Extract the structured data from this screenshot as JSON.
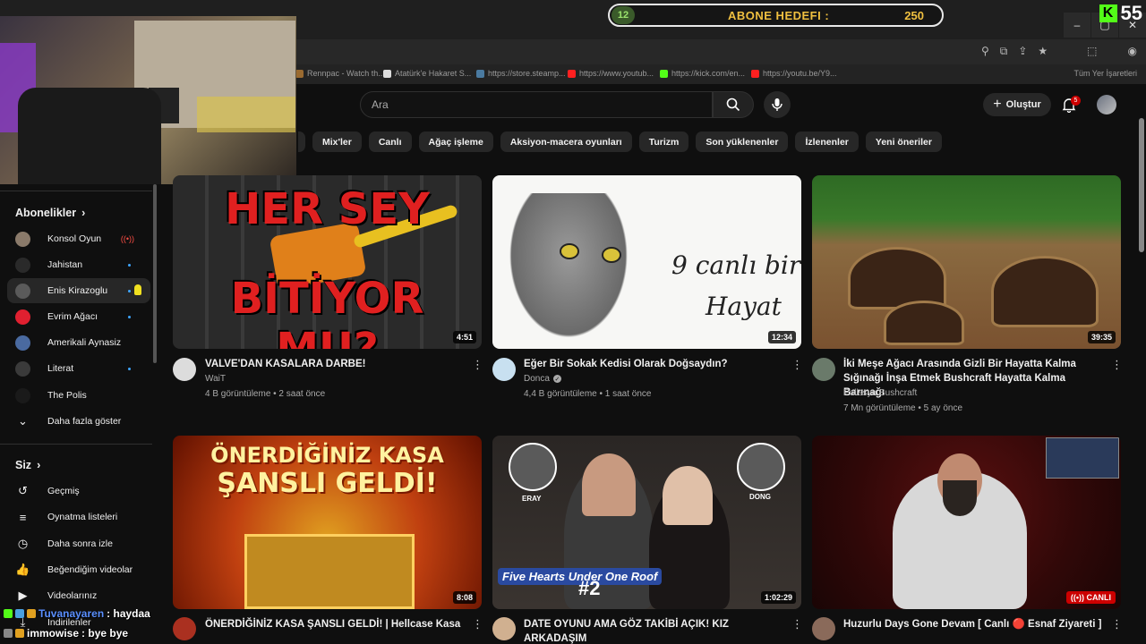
{
  "overlay": {
    "goal_count": "12",
    "goal_label": "ABONE HEDEFI :",
    "goal_target": "250",
    "kick_viewers": "55",
    "kick_logo": "K"
  },
  "window_controls": [
    "–",
    "▢",
    "✕"
  ],
  "bookmarks": [
    {
      "label": "Rennpac - Watch th...",
      "color": "#9a6a30"
    },
    {
      "label": "Atatürk'e Hakaret S...",
      "color": "#dddddd"
    },
    {
      "label": "https://store.steamp...",
      "color": "#4a7aa0"
    },
    {
      "label": "https://www.youtub...",
      "color": "#ff2020"
    },
    {
      "label": "https://kick.com/en...",
      "color": "#53fc18"
    },
    {
      "label": "https://youtu.be/Y9...",
      "color": "#ff2020"
    }
  ],
  "bookmarks_right": "Tüm Yer İşaretleri",
  "header": {
    "search_placeholder": "Ara",
    "create_label": "Oluştur",
    "notif_count": "5"
  },
  "chips": [
    "",
    "Mix'ler",
    "Canlı",
    "Ağaç işleme",
    "Aksiyon-macera oyunları",
    "Turizm",
    "Son yüklenenler",
    "İzlenenler",
    "Yeni öneriler"
  ],
  "sidebar": {
    "subs_title": "Abonelikler",
    "subs": [
      {
        "name": "Konsol Oyun",
        "color": "#8a7a6a",
        "status": "live"
      },
      {
        "name": "Jahistan",
        "color": "#2a2a2a",
        "status": "dot"
      },
      {
        "name": "Enis Kirazoglu",
        "color": "#5a5a5a",
        "status": "dot"
      },
      {
        "name": "Evrim Ağacı",
        "color": "#e02030",
        "status": "dot"
      },
      {
        "name": "Amerikali Aynasiz",
        "color": "#4a6aa0",
        "status": ""
      },
      {
        "name": "Literat",
        "color": "#3a3a3a",
        "status": "dot"
      },
      {
        "name": "The Polis",
        "color": "#1a1a1a",
        "status": ""
      }
    ],
    "show_more": "Daha fazla göster",
    "you_title": "Siz",
    "you_items": [
      {
        "label": "Geçmiş",
        "icon": "history-icon",
        "glyph": "↺"
      },
      {
        "label": "Oynatma listeleri",
        "icon": "playlists-icon",
        "glyph": "≡"
      },
      {
        "label": "Daha sonra izle",
        "icon": "watch-later-icon",
        "glyph": "◷"
      },
      {
        "label": "Beğendiğim videolar",
        "icon": "like-icon",
        "glyph": "👍"
      },
      {
        "label": "Videolarınız",
        "icon": "your-videos-icon",
        "glyph": "▶"
      },
      {
        "label": "İndirilenler",
        "icon": "downloads-icon",
        "glyph": "⤓"
      }
    ]
  },
  "videos": [
    {
      "title": "VALVE'DAN KASALARA DARBE!",
      "channel": "WaiT",
      "meta": "4 B görüntüleme • 2 saat önce",
      "duration": "4:51",
      "avatar": "#dcdcdc",
      "thumb_text1": "HER SEY",
      "thumb_text2": "BİTİYOR MU?"
    },
    {
      "title": "Eğer Bir Sokak Kedisi Olarak Doğsaydın?",
      "channel": "Donca",
      "meta": "4,4 B görüntüleme • 1 saat önce",
      "duration": "12:34",
      "avatar": "#c8e0f0",
      "thumb_text1": "9 canlı bir",
      "thumb_text2": "Hayat"
    },
    {
      "title": "İki Meşe Ağacı Arasında Gizli Bir Hayatta Kalma Sığınağı İnşa Etmek Bushcraft Hayatta Kalma Barınağı",
      "channel": "Polissya Bushcraft",
      "meta": "7 Mn görüntüleme • 5 ay önce",
      "duration": "39:35",
      "avatar": "#6a7a6a"
    },
    {
      "title": "ÖNERDİĞİNİZ KASA ŞANSLI GELDİ! | Hellcase Kasa",
      "channel": "",
      "meta": "",
      "duration": "8:08",
      "avatar": "#aa3020",
      "thumb_text1": "ÖNERDİĞİNİZ KASA",
      "thumb_text2": "ŞANSLI GELDİ!"
    },
    {
      "title": "DATE OYUNU AMA GÖZ TAKİBİ AÇIK! KIZ ARKADAŞIM",
      "channel": "",
      "meta": "",
      "duration": "1:02:29",
      "avatar": "#d0b090",
      "thumb_left": "ERAY",
      "thumb_right": "DONG",
      "thumb_brand": "Five Hearts Under One Roof",
      "thumb_num": "#2"
    },
    {
      "title": "Huzurlu Days Gone Devam [ Canlı 🔴 Esnaf Ziyareti ]",
      "channel": "",
      "meta": "",
      "live_label": "CANLI",
      "avatar": "#8a6a5a"
    }
  ],
  "chat": [
    {
      "user": "Tuvanayaren",
      "message": ": haydaa"
    },
    {
      "user": "immowise",
      "message": ": bye bye"
    }
  ]
}
